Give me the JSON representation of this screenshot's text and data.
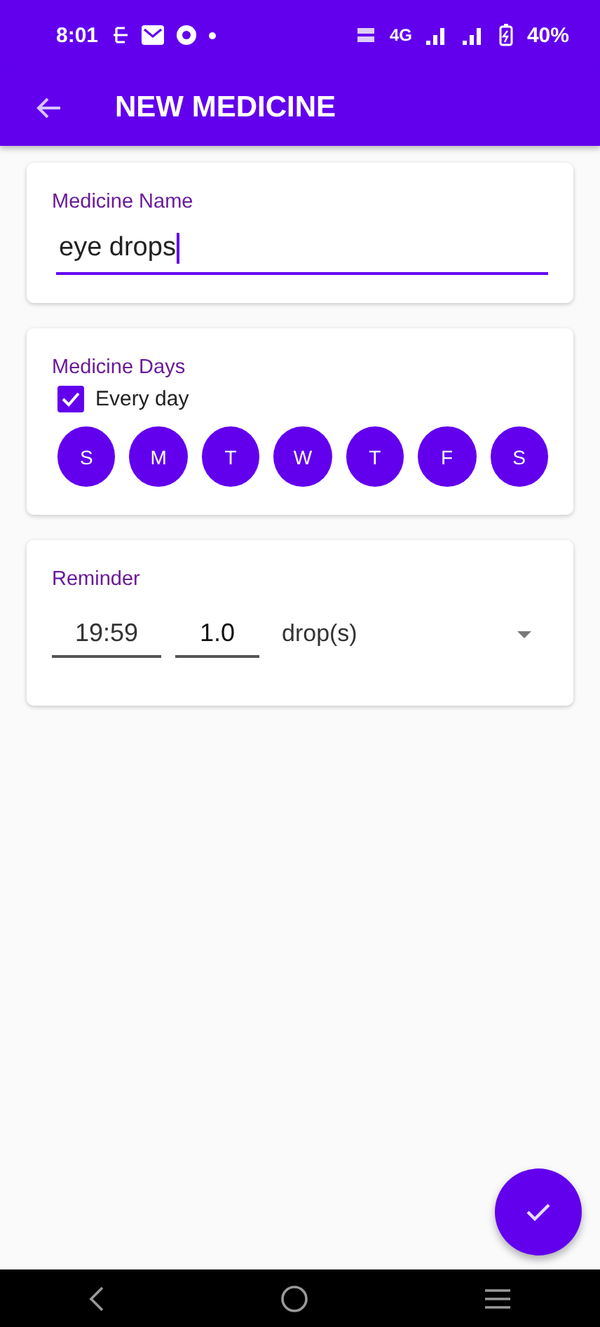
{
  "status_bar": {
    "time": "8:01",
    "network": "4G",
    "battery": "40%"
  },
  "app_bar": {
    "title": "NEW MEDICINE"
  },
  "name_card": {
    "label": "Medicine Name",
    "value": "eye drops"
  },
  "days_card": {
    "label": "Medicine Days",
    "every_day": {
      "label": "Every day",
      "checked": true
    },
    "days": [
      {
        "label": "S",
        "selected": true
      },
      {
        "label": "M",
        "selected": true
      },
      {
        "label": "T",
        "selected": true
      },
      {
        "label": "W",
        "selected": true
      },
      {
        "label": "T",
        "selected": true
      },
      {
        "label": "F",
        "selected": true
      },
      {
        "label": "S",
        "selected": true
      }
    ]
  },
  "reminder_card": {
    "label": "Reminder",
    "time": "19:59",
    "amount": "1.0",
    "unit": "drop(s)"
  }
}
